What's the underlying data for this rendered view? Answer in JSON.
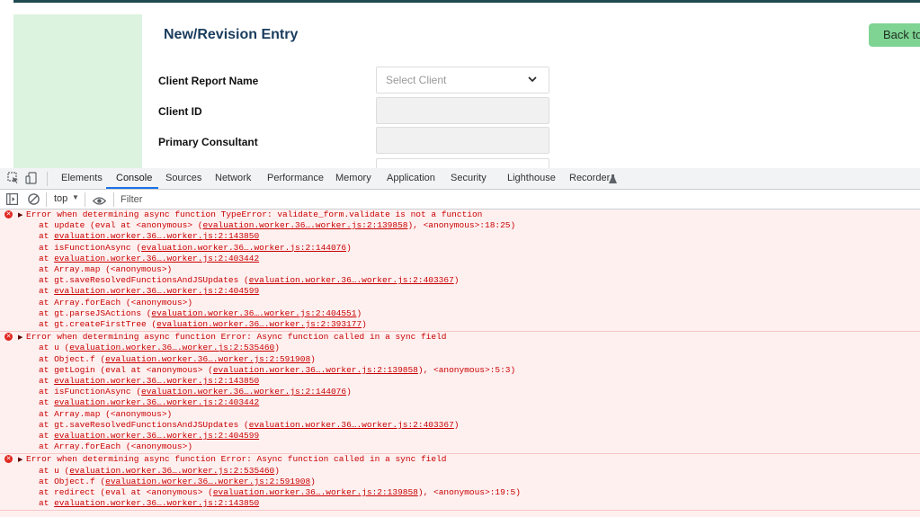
{
  "page": {
    "title": "New/Revision Entry",
    "back_button": "Back to",
    "fields": {
      "client_report_name_label": "Client Report Name",
      "client_select_placeholder": "Select Client",
      "client_id_label": "Client ID",
      "primary_consultant_label": "Primary Consultant"
    }
  },
  "devtools": {
    "tabs": [
      "Elements",
      "Console",
      "Sources",
      "Network",
      "Performance",
      "Memory",
      "Application",
      "Security",
      "Lighthouse",
      "Recorder"
    ],
    "active_tab": "Console",
    "context": "top",
    "filter_placeholder": "Filter"
  },
  "console": {
    "entries": [
      {
        "message": "Error when determining async function TypeError: validate_form.validate is not a function",
        "frames": [
          {
            "pre": "at update (eval at <anonymous> (",
            "link": "evaluation.worker.36….worker.js:2:139858",
            "post": "), <anonymous>:18:25)"
          },
          {
            "pre": "at ",
            "link": "evaluation.worker.36….worker.js:2:143850",
            "post": ""
          },
          {
            "pre": "at isFunctionAsync (",
            "link": "evaluation.worker.36….worker.js:2:144076",
            "post": ")"
          },
          {
            "pre": "at ",
            "link": "evaluation.worker.36….worker.js:2:403442",
            "post": ""
          },
          {
            "pre": "at Array.map (<anonymous>)",
            "link": "",
            "post": ""
          },
          {
            "pre": "at gt.saveResolvedFunctionsAndJSUpdates (",
            "link": "evaluation.worker.36….worker.js:2:403367",
            "post": ")"
          },
          {
            "pre": "at ",
            "link": "evaluation.worker.36….worker.js:2:404599",
            "post": ""
          },
          {
            "pre": "at Array.forEach (<anonymous>)",
            "link": "",
            "post": ""
          },
          {
            "pre": "at gt.parseJSActions (",
            "link": "evaluation.worker.36….worker.js:2:404551",
            "post": ")"
          },
          {
            "pre": "at gt.createFirstTree (",
            "link": "evaluation.worker.36….worker.js:2:393177",
            "post": ")"
          }
        ]
      },
      {
        "message": "Error when determining async function Error: Async function called in a sync field",
        "frames": [
          {
            "pre": "at u (",
            "link": "evaluation.worker.36….worker.js:2:535460",
            "post": ")"
          },
          {
            "pre": "at Object.f (",
            "link": "evaluation.worker.36….worker.js:2:591908",
            "post": ")"
          },
          {
            "pre": "at getLogin (eval at <anonymous> (",
            "link": "evaluation.worker.36….worker.js:2:139858",
            "post": "), <anonymous>:5:3)"
          },
          {
            "pre": "at ",
            "link": "evaluation.worker.36….worker.js:2:143850",
            "post": ""
          },
          {
            "pre": "at isFunctionAsync (",
            "link": "evaluation.worker.36….worker.js:2:144076",
            "post": ")"
          },
          {
            "pre": "at ",
            "link": "evaluation.worker.36….worker.js:2:403442",
            "post": ""
          },
          {
            "pre": "at Array.map (<anonymous>)",
            "link": "",
            "post": ""
          },
          {
            "pre": "at gt.saveResolvedFunctionsAndJSUpdates (",
            "link": "evaluation.worker.36….worker.js:2:403367",
            "post": ")"
          },
          {
            "pre": "at ",
            "link": "evaluation.worker.36….worker.js:2:404599",
            "post": ""
          },
          {
            "pre": "at Array.forEach (<anonymous>)",
            "link": "",
            "post": ""
          }
        ]
      },
      {
        "message": "Error when determining async function Error: Async function called in a sync field",
        "frames": [
          {
            "pre": "at u (",
            "link": "evaluation.worker.36….worker.js:2:535460",
            "post": ")"
          },
          {
            "pre": "at Object.f (",
            "link": "evaluation.worker.36….worker.js:2:591908",
            "post": ")"
          },
          {
            "pre": "at redirect (eval at <anonymous> (",
            "link": "evaluation.worker.36….worker.js:2:139858",
            "post": "), <anonymous>:19:5)"
          },
          {
            "pre": "at ",
            "link": "evaluation.worker.36….worker.js:2:143850",
            "post": ""
          }
        ]
      }
    ]
  },
  "colors": {
    "nav_green": "#dcf3df",
    "title_blue": "#1a3d5e",
    "button_green": "#7fd494",
    "error_red": "#c80000",
    "error_bg": "#fff0f0",
    "active_tab_blue": "#1a73e8"
  }
}
